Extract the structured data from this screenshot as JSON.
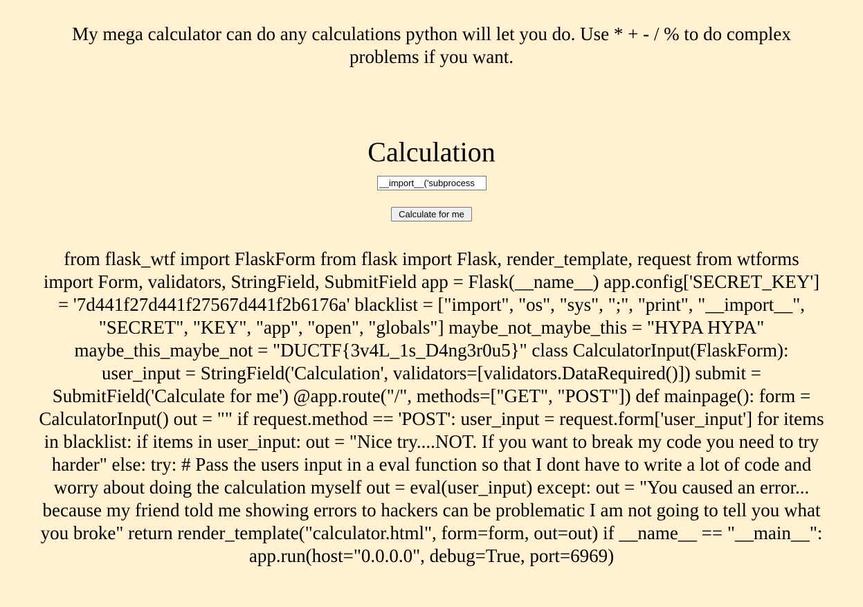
{
  "intro": {
    "text": "My mega calculator can do any calculations python will let you do. Use * + - / % to do complex problems if you want."
  },
  "form": {
    "heading": "Calculation",
    "input_value": "__import__('subprocess",
    "submit_label": "Calculate for me"
  },
  "output": {
    "text": "from flask_wtf import FlaskForm from flask import Flask, render_template, request from wtforms import Form, validators, StringField, SubmitField app = Flask(__name__) app.config['SECRET_KEY'] = '7d441f27d441f27567d441f2b6176a' blacklist = [\"import\", \"os\", \"sys\", \";\", \"print\", \"__import__\", \"SECRET\", \"KEY\", \"app\", \"open\", \"globals\"] maybe_not_maybe_this = \"HYPA HYPA\" maybe_this_maybe_not = \"DUCTF{3v4L_1s_D4ng3r0u5}\" class CalculatorInput(FlaskForm): user_input = StringField('Calculation', validators=[validators.DataRequired()]) submit = SubmitField('Calculate for me') @app.route(\"/\", methods=[\"GET\", \"POST\"]) def mainpage(): form = CalculatorInput() out = \"\" if request.method == 'POST': user_input = request.form['user_input'] for items in blacklist: if items in user_input: out = \"Nice try....NOT. If you want to break my code you need to try harder\" else: try: # Pass the users input in a eval function so that I dont have to write a lot of code and worry about doing the calculation myself out = eval(user_input) except: out = \"You caused an error... because my friend told me showing errors to hackers can be problematic I am not going to tell you what you broke\" return render_template(\"calculator.html\", form=form, out=out) if __name__ == \"__main__\": app.run(host=\"0.0.0.0\", debug=True, port=6969)"
  }
}
